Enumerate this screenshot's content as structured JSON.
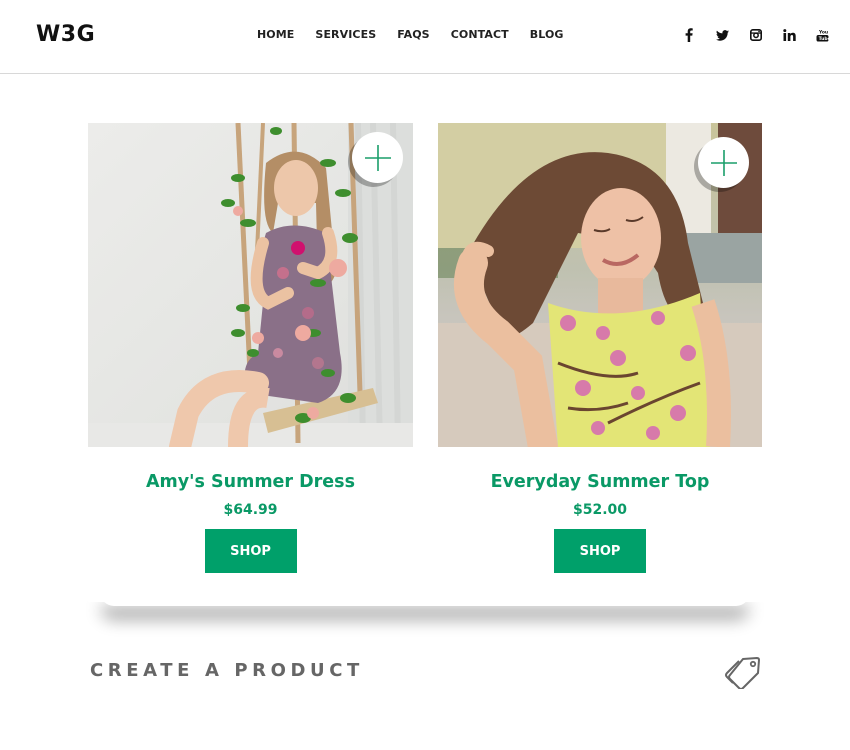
{
  "header": {
    "logo": "W3G",
    "nav": [
      "HOME",
      "SERVICES",
      "FAQS",
      "CONTACT",
      "BLOG"
    ],
    "social": [
      "facebook-icon",
      "twitter-icon",
      "instagram-icon",
      "linkedin-icon",
      "youtube-icon"
    ]
  },
  "products": [
    {
      "name": "Amy's Summer Dress",
      "price": "$64.99",
      "button": "SHOP",
      "image": "woman on flower-covered rope swing in floral dress"
    },
    {
      "name": "Everyday Summer Top",
      "price": "$52.00",
      "button": "SHOP",
      "image": "smiling woman in yellow floral sleeveless top"
    }
  ],
  "colors": {
    "accent": "#00a06a",
    "accent_text": "#0a9966",
    "heading_gray": "#666666"
  },
  "footer": {
    "create_label": "CREATE A PRODUCT",
    "icon": "price-tag-icon"
  }
}
